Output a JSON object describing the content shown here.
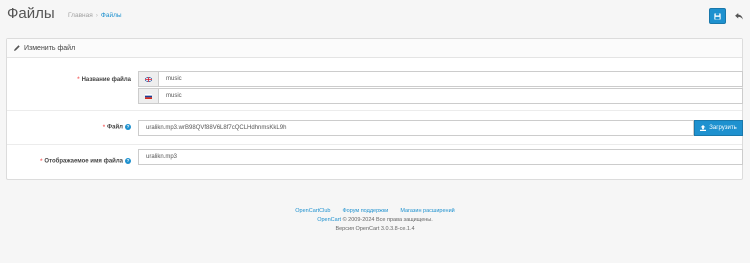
{
  "header": {
    "title": "Файлы",
    "breadcrumb": [
      "Главная",
      "Файлы"
    ],
    "save_icon": "floppy-disk-icon",
    "back_icon": "reply-icon"
  },
  "panel": {
    "heading": "Изменить файл",
    "heading_icon": "pencil-icon"
  },
  "form": {
    "name_label": "Название файла",
    "name_values": [
      {
        "flag": "en-gb-flag-icon",
        "value": "music"
      },
      {
        "flag": "ru-flag-icon",
        "value": "music"
      }
    ],
    "file_label": "Файл",
    "file_value": "uralikn.mp3.wrB98QVf88V6L8f7cQCLHdhnmsKkL9h",
    "upload_label": "Загрузить",
    "mask_label": "Отображаемое имя файла",
    "mask_value": "uralikn.mp3"
  },
  "footer": {
    "links": [
      "OpenCartClub",
      "Форум поддержки",
      "Магазин расширений"
    ],
    "copyright_brand": "OpenCart",
    "copyright_text": "© 2009-2024 Все права защищены.",
    "version": "Версия OpenCart 3.0.3.8-ce.1.4"
  },
  "colors": {
    "accent": "#1e91cf",
    "required": "#f56b6b"
  }
}
